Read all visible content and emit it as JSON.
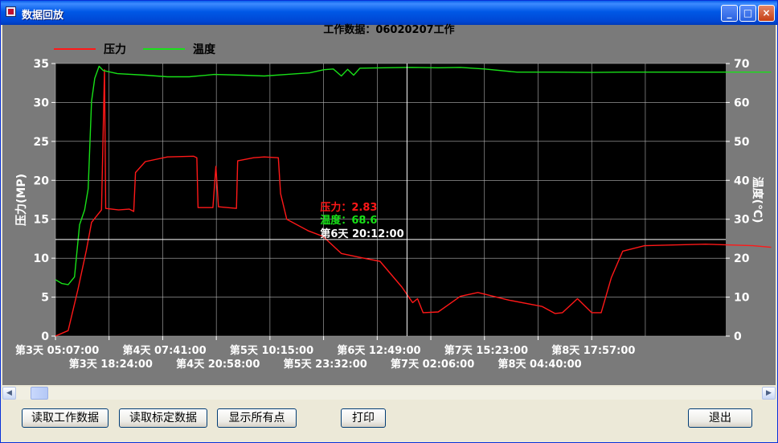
{
  "window": {
    "title": "数据回放",
    "controls": {
      "minimize": "_",
      "maximize": "□",
      "close": "×"
    }
  },
  "chart_title": "工作数据：06020207工作",
  "legend": [
    {
      "name": "压力",
      "color": "#FF1818"
    },
    {
      "name": "温度",
      "color": "#18E018"
    }
  ],
  "left_axis": {
    "label": "压力(MP)",
    "ticks": [
      "0",
      "5",
      "10",
      "15",
      "20",
      "25",
      "30",
      "35"
    ]
  },
  "right_axis": {
    "label": "温度(℃)",
    "ticks": [
      "0",
      "10",
      "20",
      "30",
      "40",
      "50",
      "60",
      "70"
    ]
  },
  "x_ticks_top": [
    "第3天 05:07:00",
    "第4天 07:41:00",
    "第5天 10:15:00",
    "第6天 12:49:00",
    "第7天 15:23:00",
    "第8天 17:57:00"
  ],
  "x_ticks_bottom": [
    "第3天 18:24:00",
    "第4天 20:58:00",
    "第5天 23:32:00",
    "第7天 02:06:00",
    "第8天 04:40:00"
  ],
  "cursor": {
    "pressure_label": "压力：2.83",
    "temperature_label": "温度：68.6",
    "time_label": "第6天 20:12:00"
  },
  "buttons": {
    "read_work": "读取工作数据",
    "read_calib": "读取标定数据",
    "show_all": "显示所有点",
    "print": "打印",
    "exit": "退出"
  },
  "colors": {
    "pressure": "#FF1818",
    "temperature": "#18E018",
    "plot_bg": "#000000",
    "panel_bg": "#7A7A7A",
    "grid": "#B4B4B4",
    "cursor": "#FFFFFF"
  },
  "chart_data": {
    "type": "line",
    "title": "工作数据：06020207工作",
    "ylabel": "压力(MP)",
    "y2label": "温度(℃)",
    "ylim": [
      0,
      35
    ],
    "y2lim": [
      0,
      70
    ],
    "x_start": "第3天 05:07:00",
    "x_end": "第8天 17:57:00",
    "series": [
      {
        "name": "压力",
        "axis": "left",
        "points": [
          [
            "第3天 05:07:00",
            0.0
          ],
          [
            "第3天 08:16:00",
            0.7
          ],
          [
            "第3天 10:42:00",
            6.0
          ],
          [
            "第3天 12:46:00",
            11.0
          ],
          [
            "第3天 14:03:00",
            14.6
          ],
          [
            "第3天 16:32:00",
            16.2
          ],
          [
            "第3天 17:16:00",
            34.2
          ],
          [
            "第3天 17:33:00",
            16.4
          ],
          [
            "第3天 20:46:00",
            16.2
          ],
          [
            "第3天 23:25:00",
            16.3
          ],
          [
            "第4天 00:31:00",
            16.0
          ],
          [
            "第4天 00:57:00",
            21.0
          ],
          [
            "第4天 03:22:00",
            22.4
          ],
          [
            "第4天 08:51:00",
            23.0
          ],
          [
            "第4天 15:19:00",
            23.1
          ],
          [
            "第4天 16:08:00",
            22.9
          ],
          [
            "第4天 16:26:00",
            16.5
          ],
          [
            "第4天 20:07:00",
            16.5
          ],
          [
            "第4天 20:51:00",
            21.8
          ],
          [
            "第4天 21:29:00",
            16.6
          ],
          [
            "第5天 01:57:00",
            16.4
          ],
          [
            "第5天 02:15:00",
            22.5
          ],
          [
            "第5天 06:11:00",
            22.9
          ],
          [
            "第5天 08:51:00",
            23.0
          ],
          [
            "第5天 12:19:00",
            22.9
          ],
          [
            "第5天 12:53:00",
            18.3
          ],
          [
            "第5天 14:25:00",
            15.0
          ],
          [
            "第5天 19:47:00",
            13.5
          ],
          [
            "第5天 23:24:00",
            12.8
          ],
          [
            "第6天 03:56:00",
            10.6
          ],
          [
            "第6天 09:24:00",
            10.0
          ],
          [
            "第6天 13:31:00",
            9.6
          ],
          [
            "第6天 18:56:00",
            6.3
          ],
          [
            "第6天 21:36:00",
            4.3
          ],
          [
            "第6天 22:49:00",
            4.8
          ],
          [
            "第7天 00:11:00",
            3.0
          ],
          [
            "第7天 03:56:00",
            3.1
          ],
          [
            "第7天 09:24:00",
            5.1
          ],
          [
            "第7天 13:45:00",
            5.6
          ],
          [
            "第7天 21:32:00",
            4.6
          ],
          [
            "第8天 05:41:00",
            3.8
          ],
          [
            "第8天 08:51:00",
            2.9
          ],
          [
            "第8天 10:42:00",
            3.0
          ],
          [
            "第8天 14:25:00",
            4.8
          ],
          [
            "第8天 17:57:00",
            3.0
          ],
          [
            "第8天 20:18:00",
            3.0
          ],
          [
            "第8天 22:49:00",
            7.5
          ],
          [
            "第9天 01:38:00",
            10.9
          ],
          [
            "第9天 07:03:00",
            11.6
          ],
          [
            "第9天 22:10:00",
            11.8
          ],
          [
            "第10天 09:51:00",
            11.6
          ],
          [
            "第10天 14:25:00",
            11.4
          ]
        ]
      },
      {
        "name": "温度",
        "axis": "right",
        "points": [
          [
            "第3天 05:07:00",
            14.5
          ],
          [
            "第3天 06:41:00",
            13.5
          ],
          [
            "第3天 08:16:00",
            13.2
          ],
          [
            "第3天 09:50:00",
            15.2
          ],
          [
            "第3天 11:05:00",
            28.6
          ],
          [
            "第3天 12:21:00",
            32.4
          ],
          [
            "第3天 13:13:00",
            37.8
          ],
          [
            "第3天 14:03:00",
            60.3
          ],
          [
            "第3天 14:51:00",
            66.2
          ],
          [
            "第3天 15:56:00",
            69.3
          ],
          [
            "第3天 16:57:00",
            68.2
          ],
          [
            "第3天 20:28:00",
            67.4
          ],
          [
            "第4天 03:22:00",
            67.0
          ],
          [
            "第4天 08:51:00",
            66.6
          ],
          [
            "第4天 14:13:00",
            66.6
          ],
          [
            "第4天 20:28:00",
            67.2
          ],
          [
            "第5天 03:22:00",
            67.0
          ],
          [
            "第5天 08:51:00",
            66.8
          ],
          [
            "第5天 14:25:00",
            67.2
          ],
          [
            "第5天 20:07:00",
            67.6
          ],
          [
            "第5天 23:38:00",
            68.4
          ],
          [
            "第6天 01:57:00",
            68.6
          ],
          [
            "第6天 03:56:00",
            66.8
          ],
          [
            "第6天 05:29:00",
            68.5
          ],
          [
            "第6天 06:59:00",
            67.0
          ],
          [
            "第6天 08:32:00",
            68.8
          ],
          [
            "第6天 14:25:00",
            68.9
          ],
          [
            "第6天 21:36:00",
            69.0
          ],
          [
            "第7天 03:56:00",
            68.9
          ],
          [
            "第7天 09:24:00",
            69.0
          ],
          [
            "第7天 15:23:00",
            68.6
          ],
          [
            "第7天 23:25:00",
            67.8
          ],
          [
            "第8天 08:51:00",
            67.8
          ],
          [
            "第8天 17:57:00",
            67.7
          ],
          [
            "第9天 01:38:00",
            67.8
          ],
          [
            "第9天 09:24:00",
            67.8
          ],
          [
            "第10天 14:25:00",
            67.8
          ]
        ]
      }
    ],
    "cursor": {
      "x": "第6天 20:12:00",
      "pressure": 2.83,
      "temperature": 68.6
    },
    "grid": true,
    "legend_position": "top-left"
  }
}
